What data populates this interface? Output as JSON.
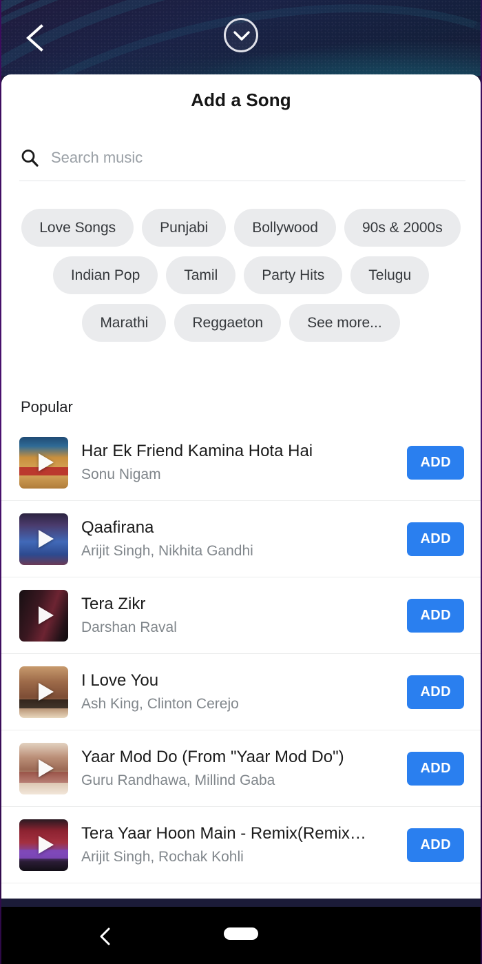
{
  "top_bar": {
    "back_icon": "chevron-left-icon",
    "collapse_icon": "chevron-down-circle-icon"
  },
  "sheet": {
    "title": "Add a Song"
  },
  "search": {
    "icon": "search-icon",
    "value": "",
    "placeholder": "Search music"
  },
  "genres": [
    {
      "label": "Love Songs"
    },
    {
      "label": "Punjabi"
    },
    {
      "label": "Bollywood"
    },
    {
      "label": "90s & 2000s"
    },
    {
      "label": "Indian Pop"
    },
    {
      "label": "Tamil"
    },
    {
      "label": "Party Hits"
    },
    {
      "label": "Telugu"
    },
    {
      "label": "Marathi"
    },
    {
      "label": "Reggaeton"
    },
    {
      "label": "See more..."
    }
  ],
  "popular": {
    "heading": "Popular",
    "add_label": "ADD",
    "songs": [
      {
        "title": "Har Ek Friend Kamina Hota Hai",
        "artist": "Sonu Nigam",
        "add_label": "ADD",
        "art_colors": [
          "#c8913f",
          "#2a5d86",
          "#e2c08a"
        ]
      },
      {
        "title": "Qaafirana",
        "artist": "Arijit Singh, Nikhita Gandhi",
        "add_label": "ADD",
        "art_colors": [
          "#3a5ba8",
          "#7a4a6e",
          "#1d2a4d"
        ]
      },
      {
        "title": "Tera Zikr",
        "artist": "Darshan Raval",
        "add_label": "ADD",
        "art_colors": [
          "#1a1114",
          "#6a2230",
          "#0d0a0c"
        ]
      },
      {
        "title": "I Love You",
        "artist": "Ash King, Clinton Cerejo",
        "add_label": "ADD",
        "art_colors": [
          "#b98a5e",
          "#5d3b2a",
          "#e6cfae"
        ]
      },
      {
        "title": "Yaar Mod Do (From \"Yaar Mod Do\")",
        "artist": "Guru Randhawa, Millind Gaba",
        "add_label": "ADD",
        "art_colors": [
          "#d9c3ad",
          "#8e5c4a",
          "#f0e3d4"
        ]
      },
      {
        "title": "Tera Yaar Hoon Main - Remix(Remix…",
        "artist": "Arijit Singh, Rochak Kohli",
        "add_label": "ADD",
        "art_colors": [
          "#8c2230",
          "#7b49b0",
          "#1a1320"
        ]
      }
    ]
  },
  "nav_bar": {
    "back_icon": "nav-back-icon",
    "home_pill": "home-indicator"
  },
  "colors": {
    "accent_blue": "#2a7fef",
    "chip_bg": "#eaebed",
    "title_text": "#1b1b1b",
    "artist_text": "#80868b",
    "top_bg": "#1b1b38"
  }
}
